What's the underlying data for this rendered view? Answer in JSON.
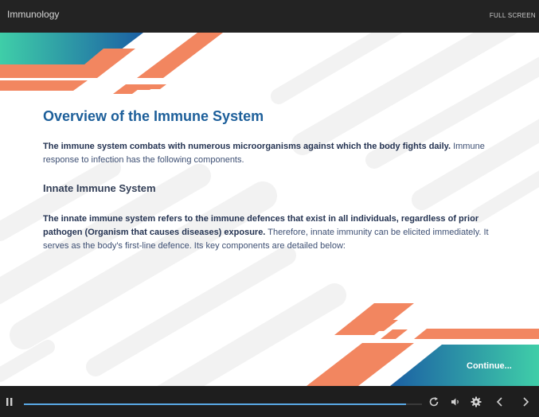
{
  "app": {
    "title": "Immunology",
    "fullscreen_label": "FULL SCREEN"
  },
  "slide": {
    "heading": "Overview of the Immune System",
    "intro_bold": "The immune system combats with numerous microorganisms against which the body fights daily.",
    "intro_rest": " Immune response to infection has the following components.",
    "section_heading": "Innate Immune System",
    "para_bold": "The innate immune system refers to the immune defences that exist in all individuals, regardless of prior pathogen (Organism that causes diseases) exposure.",
    "para_rest": " Therefore, innate immunity can be elicited immediately. It serves as the body's first-line defence. Its key components are detailed below:",
    "continue_label": "Continue..."
  },
  "player": {
    "progress": 0.96
  },
  "icons": {
    "pause": "pause-icon",
    "replay": "replay-icon",
    "volume": "volume-icon",
    "settings": "gear-icon",
    "previous": "chevron-left-icon",
    "next": "chevron-right-icon"
  },
  "colors": {
    "heading": "#1d5f9a",
    "accent_orange": "#f28660",
    "accent_teal": "#3fcea8",
    "accent_blue": "#1b5fa4",
    "progress": "#5aa9e6"
  }
}
